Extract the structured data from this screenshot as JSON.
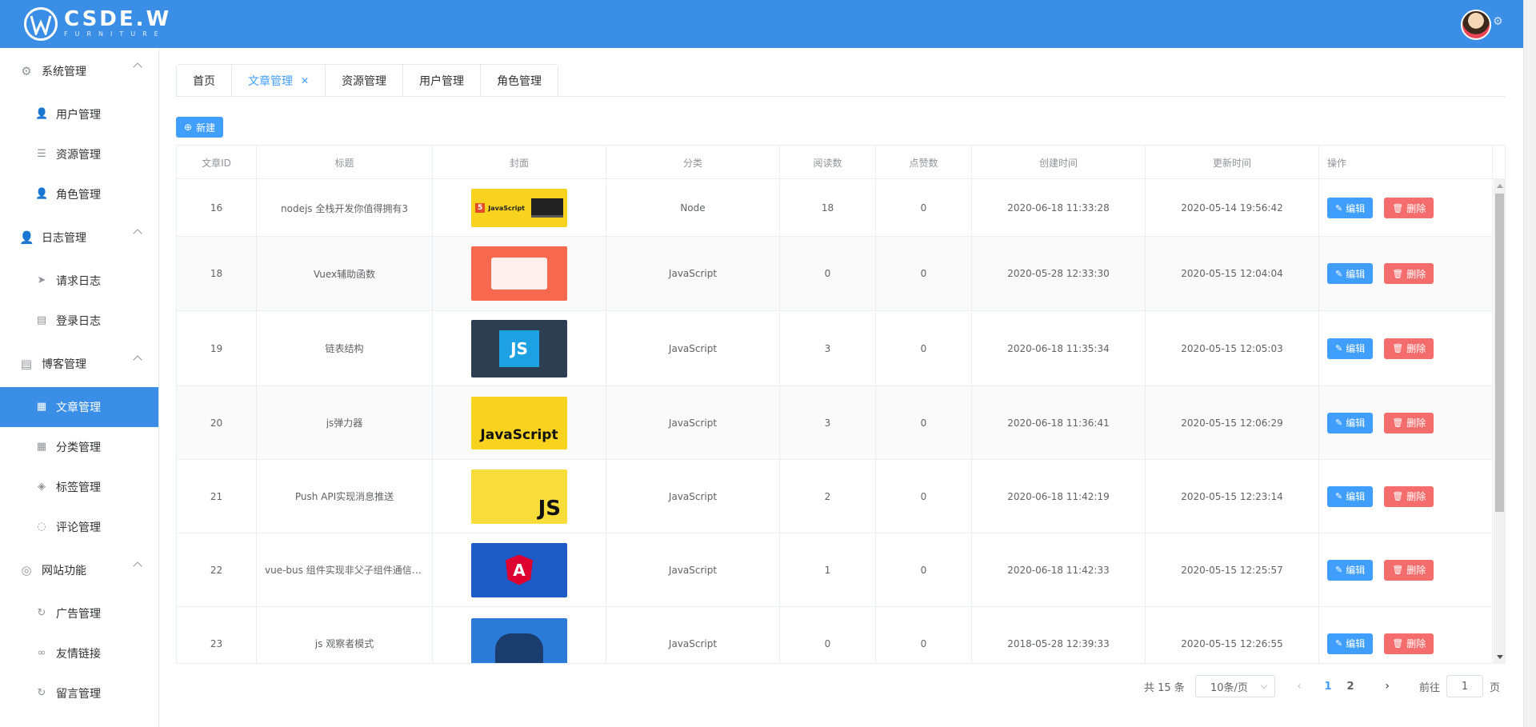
{
  "header": {
    "logo_text": "CSDE.W",
    "logo_sub": "FURNITURE"
  },
  "sidebar": {
    "groups": [
      {
        "label": "系统管理",
        "icon": "gear-icon",
        "items": [
          {
            "label": "用户管理",
            "icon": "user-icon"
          },
          {
            "label": "资源管理",
            "icon": "list-icon"
          },
          {
            "label": "角色管理",
            "icon": "user-icon"
          }
        ]
      },
      {
        "label": "日志管理",
        "icon": "user-icon",
        "items": [
          {
            "label": "请求日志",
            "icon": "send-icon"
          },
          {
            "label": "登录日志",
            "icon": "document-icon"
          }
        ]
      },
      {
        "label": "博客管理",
        "icon": "document-icon",
        "items": [
          {
            "label": "文章管理",
            "icon": "notebook-icon",
            "active": true
          },
          {
            "label": "分类管理",
            "icon": "grid-icon"
          },
          {
            "label": "标签管理",
            "icon": "tags-icon"
          },
          {
            "label": "评论管理",
            "icon": "chat-icon"
          }
        ]
      },
      {
        "label": "网站功能",
        "icon": "database-icon",
        "items": [
          {
            "label": "广告管理",
            "icon": "refresh-icon"
          },
          {
            "label": "友情链接",
            "icon": "link-icon"
          },
          {
            "label": "留言管理",
            "icon": "refresh-icon"
          }
        ]
      }
    ]
  },
  "tabs": [
    {
      "label": "首页",
      "active": false
    },
    {
      "label": "文章管理",
      "active": true,
      "closable": true
    },
    {
      "label": "资源管理",
      "active": false
    },
    {
      "label": "用户管理",
      "active": false
    },
    {
      "label": "角色管理",
      "active": false
    }
  ],
  "toolbar": {
    "new_label": "新建"
  },
  "table": {
    "columns": [
      "文章ID",
      "标题",
      "封面",
      "分类",
      "阅读数",
      "点赞数",
      "创建时间",
      "更新时间",
      "操作"
    ],
    "edit_label": "编辑",
    "delete_label": "删除",
    "rows": [
      {
        "id": "16",
        "title": "nodejs 全栈开发你值得拥有3",
        "cover": {
          "kind": "js-laptop",
          "bg": "#f7d21e"
        },
        "category": "Node",
        "views": "18",
        "likes": "0",
        "created": "2020-06-18 11:33:28",
        "updated": "2020-05-14 19:56:42"
      },
      {
        "id": "18",
        "title": "Vuex辅助函数",
        "cover": {
          "kind": "people",
          "bg": "#f7694f"
        },
        "category": "JavaScript",
        "views": "0",
        "likes": "0",
        "created": "2020-05-28 12:33:30",
        "updated": "2020-05-15 12:04:04"
      },
      {
        "id": "19",
        "title": "链表结构",
        "cover": {
          "kind": "js-square",
          "bg": "#2c3e50"
        },
        "category": "JavaScript",
        "views": "3",
        "likes": "0",
        "created": "2020-06-18 11:35:34",
        "updated": "2020-05-15 12:05:03"
      },
      {
        "id": "20",
        "title": "js弹力器",
        "cover": {
          "kind": "javascript-text",
          "bg": "#f7d21e"
        },
        "category": "JavaScript",
        "views": "3",
        "likes": "0",
        "created": "2020-06-18 11:36:41",
        "updated": "2020-05-15 12:06:29"
      },
      {
        "id": "21",
        "title": "Push API实现消息推送",
        "cover": {
          "kind": "js-corner",
          "bg": "#f7dc3a"
        },
        "category": "JavaScript",
        "views": "2",
        "likes": "0",
        "created": "2020-06-18 11:42:19",
        "updated": "2020-05-15 12:23:14"
      },
      {
        "id": "22",
        "title": "vue-bus 组件实现非父子组件通信(...",
        "cover": {
          "kind": "angular",
          "bg": "#1e5bc6"
        },
        "category": "JavaScript",
        "views": "1",
        "likes": "0",
        "created": "2020-06-18 11:42:33",
        "updated": "2020-05-15 12:25:57"
      },
      {
        "id": "23",
        "title": "js 观察者模式",
        "cover": {
          "kind": "coder",
          "bg": "#2d7bd8"
        },
        "category": "JavaScript",
        "views": "0",
        "likes": "0",
        "created": "2018-05-28 12:39:33",
        "updated": "2020-05-15 12:26:55"
      }
    ]
  },
  "pagination": {
    "total_text": "共 15 条",
    "page_size": "10条/页",
    "pages": [
      "1",
      "2"
    ],
    "current": "1",
    "goto_label": "前往",
    "goto_value": "1",
    "page_suffix": "页"
  }
}
